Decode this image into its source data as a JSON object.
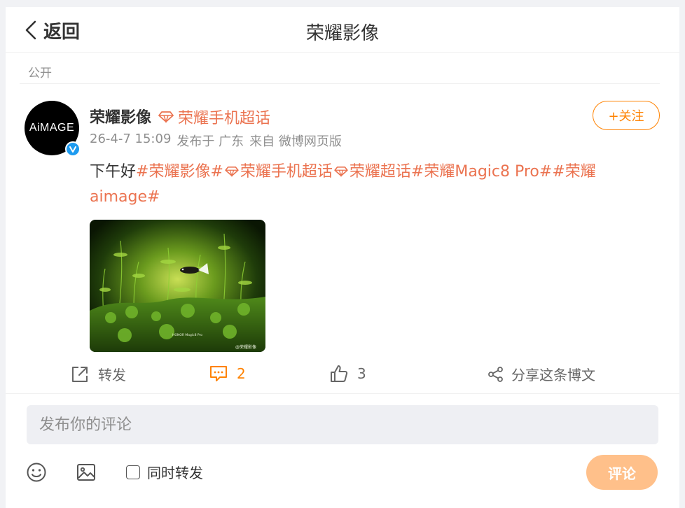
{
  "header": {
    "back_label": "返回",
    "title": "荣耀影像"
  },
  "visibility": "公开",
  "post": {
    "avatar_text": "AiMAGE",
    "author": "荣耀影像",
    "supertopic": "荣耀手机超话",
    "follow_label": "+关注",
    "meta": {
      "date": "26-4-7 15:09",
      "location": "发布于 广东",
      "source": "来自 微博网页版"
    },
    "text": {
      "intro": "下午好",
      "tag1": "#荣耀影像#",
      "tag2": "荣耀手机超话",
      "tag3": "荣耀超话",
      "tag4": "#荣耀Magic8 Pro#",
      "tag5": "#荣耀aimage#"
    },
    "photo": {
      "watermark_device": "HONOR Magic8 Pro",
      "watermark_credit": "@荣耀影像"
    }
  },
  "actions": {
    "repost_label": "转发",
    "comment_count": "2",
    "like_count": "3",
    "share_label": "分享这条博文"
  },
  "composer": {
    "placeholder": "发布你的评论",
    "sync_label": "同时转发",
    "submit_label": "评论"
  },
  "colors": {
    "accent_orange": "#ff8200",
    "topic_orange": "#eb7350",
    "submit_disabled": "#ffc08a",
    "verified_blue": "#1d9bf0"
  }
}
